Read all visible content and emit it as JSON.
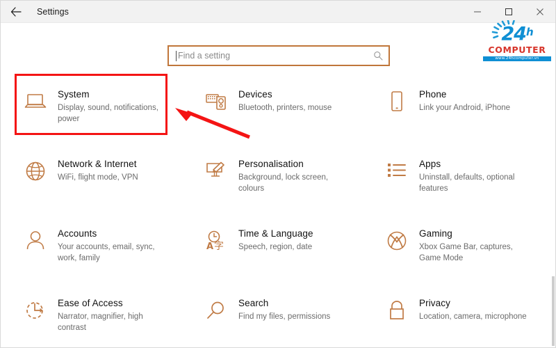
{
  "window": {
    "title": "Settings",
    "back_icon": "back-arrow-icon",
    "controls": {
      "minimize": "minimize-icon",
      "maximize": "maximize-icon",
      "close": "close-icon"
    }
  },
  "search": {
    "placeholder": "Find a setting",
    "value": "",
    "icon": "search-icon"
  },
  "logo": {
    "number": "24",
    "superscript": "h",
    "word": "COMPUTER",
    "url": "www.24hcomputer.vn",
    "blue": "#0f8fd4",
    "red": "#d7352b"
  },
  "annotations": {
    "highlight_color": "#f41414",
    "arrow_color": "#f41414",
    "highlighted_tile": "System"
  },
  "theme": {
    "icon_color": "#c07b45",
    "search_border": "#c0763a",
    "title_color": "#111111",
    "subtitle_color": "#6b6b6b"
  },
  "tiles": [
    {
      "icon": "laptop-icon",
      "title": "System",
      "subtitle": "Display, sound, notifications, power"
    },
    {
      "icon": "devices-icon",
      "title": "Devices",
      "subtitle": "Bluetooth, printers, mouse"
    },
    {
      "icon": "phone-icon",
      "title": "Phone",
      "subtitle": "Link your Android, iPhone"
    },
    {
      "icon": "globe-icon",
      "title": "Network & Internet",
      "subtitle": "WiFi, flight mode, VPN"
    },
    {
      "icon": "paintbrush-icon",
      "title": "Personalisation",
      "subtitle": "Background, lock screen, colours"
    },
    {
      "icon": "list-icon",
      "title": "Apps",
      "subtitle": "Uninstall, defaults, optional features"
    },
    {
      "icon": "person-icon",
      "title": "Accounts",
      "subtitle": "Your accounts, email, sync, work, family"
    },
    {
      "icon": "clock-language-icon",
      "title": "Time & Language",
      "subtitle": "Speech, region, date"
    },
    {
      "icon": "xbox-icon",
      "title": "Gaming",
      "subtitle": "Xbox Game Bar, captures, Game Mode"
    },
    {
      "icon": "ease-of-access-icon",
      "title": "Ease of Access",
      "subtitle": "Narrator, magnifier, high contrast"
    },
    {
      "icon": "magnifier-icon",
      "title": "Search",
      "subtitle": "Find my files, permissions"
    },
    {
      "icon": "lock-icon",
      "title": "Privacy",
      "subtitle": "Location, camera, microphone"
    }
  ]
}
